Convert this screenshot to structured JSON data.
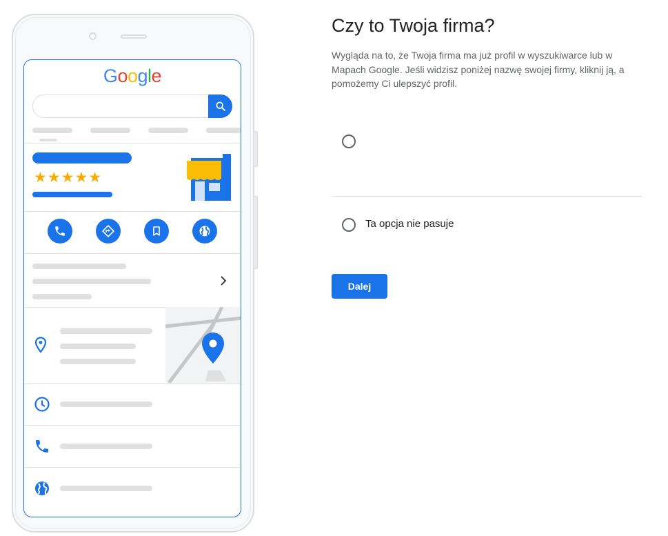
{
  "illustration": {
    "logo_letters": [
      {
        "char": "G",
        "color": "#4285F4"
      },
      {
        "char": "o",
        "color": "#EA4335"
      },
      {
        "char": "o",
        "color": "#FBBC05"
      },
      {
        "char": "g",
        "color": "#4285F4"
      },
      {
        "char": "l",
        "color": "#34A853"
      },
      {
        "char": "e",
        "color": "#EA4335"
      }
    ],
    "rating_stars": "★★★★★",
    "icons": [
      "search-icon",
      "store-icon",
      "phone-icon",
      "directions-icon",
      "bookmark-icon",
      "globe-icon",
      "chevron-right-icon",
      "location-pin-icon",
      "map-pin-icon",
      "clock-icon"
    ],
    "colors": {
      "accent": "#1a73e8",
      "star": "#f9ab00",
      "awning": "#fbbc04",
      "placeholder": "#e0e0e0"
    }
  },
  "page": {
    "title": "Czy to Twoja firma?",
    "description": "Wygląda na to, że Twoja firma ma już profil w wyszukiwarce lub w Mapach Google. Jeśli widzisz poniżej nazwę swojej firmy, kliknij ją, a pomożemy Ci ulepszyć profil."
  },
  "options": [
    {
      "label": "",
      "selected": false
    },
    {
      "label": "Ta opcja nie pasuje",
      "selected": false
    }
  ],
  "actions": {
    "next_label": "Dalej"
  }
}
